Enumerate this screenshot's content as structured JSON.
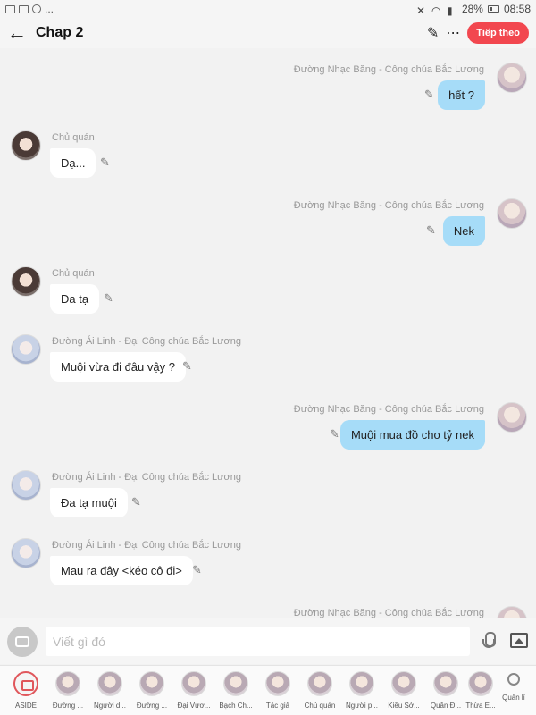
{
  "status": {
    "battery": "28%",
    "time": "08:58"
  },
  "header": {
    "title": "Chap 2",
    "next_label": "Tiếp theo"
  },
  "messages": [
    {
      "side": "out",
      "name": "Đường Nhạc Băng - Công chúa Bắc Lương",
      "text": "hết ?"
    },
    {
      "side": "in",
      "name": "Chủ quán",
      "text": "Dạ..."
    },
    {
      "side": "out",
      "name": "Đường Nhạc Băng - Công chúa Bắc Lương",
      "text": "Nek"
    },
    {
      "side": "in",
      "name": "Chủ quán",
      "text": "Đa tạ"
    },
    {
      "side": "in",
      "name": "Đường Ái Linh - Đại Công chúa Bắc Lương",
      "text": "Muội vừa đi đâu vậy ?"
    },
    {
      "side": "out",
      "name": "Đường Nhạc Băng - Công chúa Bắc Lương",
      "text": "Muội mua đồ cho tỷ nek"
    },
    {
      "side": "in",
      "name": "Đường Ái Linh - Đại Công chúa Bắc Lương",
      "text": "Đa tạ muội"
    },
    {
      "side": "in",
      "name": "Đường Ái Linh - Đại Công chúa Bắc Lương",
      "text": "Mau ra đây <kéo cô đi>"
    },
    {
      "side": "out",
      "name": "Đường Nhạc Băng - Công chúa Bắc Lương",
      "text": ""
    }
  ],
  "input": {
    "placeholder": "Viết gì đó"
  },
  "characters": [
    {
      "label": "ASIDE"
    },
    {
      "label": "Đường ..."
    },
    {
      "label": "Người d..."
    },
    {
      "label": "Đường ..."
    },
    {
      "label": "Đại Vươ..."
    },
    {
      "label": "Bạch Ch..."
    },
    {
      "label": "Tác giả"
    },
    {
      "label": "Chủ quán"
    },
    {
      "label": "Người p..."
    },
    {
      "label": "Kiều Sở..."
    },
    {
      "label": "Quân Đ..."
    },
    {
      "label": "Thừa E..."
    }
  ],
  "manage_label": "Quản lí"
}
